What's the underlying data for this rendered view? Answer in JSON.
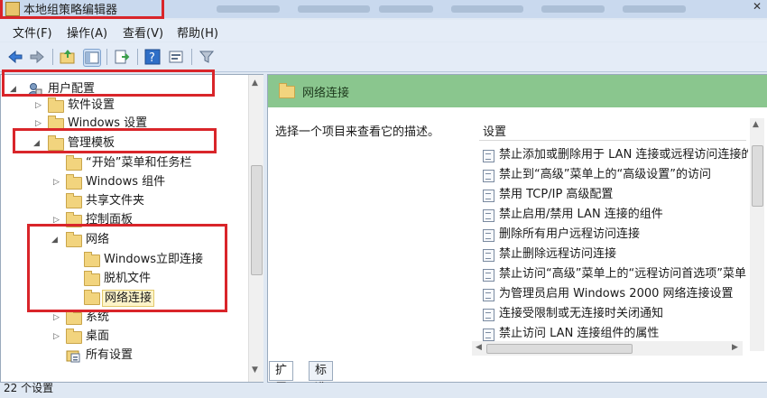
{
  "window": {
    "title": "本地组策略编辑器"
  },
  "menu": [
    {
      "label": "文件(F)"
    },
    {
      "label": "操作(A)"
    },
    {
      "label": "查看(V)"
    },
    {
      "label": "帮助(H)"
    }
  ],
  "tree": [
    {
      "label": "用户配置",
      "icon": "user-config-icon",
      "expanded": true
    },
    {
      "label": "软件设置",
      "icon": "folder-icon",
      "expanded": false
    },
    {
      "label": "Windows 设置",
      "icon": "folder-icon",
      "expanded": false
    },
    {
      "label": "管理模板",
      "icon": "folder-icon",
      "expanded": true
    },
    {
      "label": "“开始”菜单和任务栏",
      "icon": "folder-icon"
    },
    {
      "label": "Windows 组件",
      "icon": "folder-icon",
      "expanded": false
    },
    {
      "label": "共享文件夹",
      "icon": "folder-icon"
    },
    {
      "label": "控制面板",
      "icon": "folder-icon",
      "expanded": false
    },
    {
      "label": "网络",
      "icon": "folder-icon",
      "expanded": true
    },
    {
      "label": "Windows立即连接",
      "icon": "folder-icon"
    },
    {
      "label": "脱机文件",
      "icon": "folder-icon"
    },
    {
      "label": "网络连接",
      "icon": "folder-icon",
      "selected": true
    },
    {
      "label": "系统",
      "icon": "folder-icon",
      "expanded": false
    },
    {
      "label": "桌面",
      "icon": "folder-icon",
      "expanded": false
    },
    {
      "label": "所有设置",
      "icon": "all-settings-icon"
    }
  ],
  "details": {
    "title": "网络连接",
    "description": "选择一个项目来查看它的描述。",
    "column_header": "设置",
    "settings": [
      "禁止添加或删除用于 LAN 连接或远程访问连接的",
      "禁止到“高级”菜单上的“高级设置”的访问",
      "禁用 TCP/IP 高级配置",
      "禁止启用/禁用 LAN 连接的组件",
      "删除所有用户远程访问连接",
      "禁止删除远程访问连接",
      "禁止访问“高级”菜单上的“远程访问首选项”菜单",
      "为管理员启用 Windows 2000 网络连接设置",
      "连接受限制或无连接时关闭通知",
      "禁止访问 LAN 连接组件的属性"
    ]
  },
  "tabs": [
    {
      "label": "扩展"
    },
    {
      "label": "标准"
    }
  ],
  "status": {
    "text": "22 个设置"
  },
  "colors": {
    "header_band": "#8ac68e",
    "highlight_box": "#d9252a",
    "folder": "#f2d47e"
  }
}
